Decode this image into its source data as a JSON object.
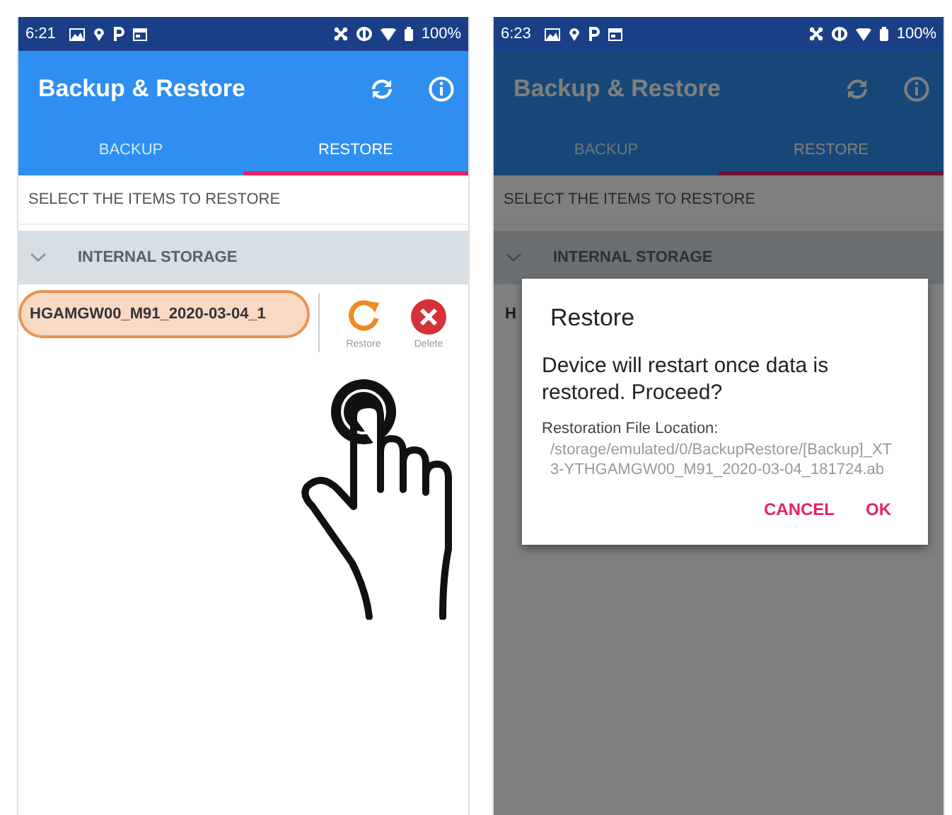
{
  "screens": [
    {
      "dimmed": false,
      "tap_hint": true,
      "status_bar": {
        "time": "6:21",
        "battery": "100%"
      },
      "app_bar": {
        "title": "Backup & Restore"
      },
      "tabs": [
        {
          "label": "BACKUP",
          "selected": false
        },
        {
          "label": "RESTORE",
          "selected": true
        }
      ],
      "section_header": "SELECT THE ITEMS TO RESTORE",
      "group": {
        "label": "INTERNAL STORAGE",
        "expanded": true
      },
      "items": [
        {
          "name": "HGAMGW00_M91_2020-03-04_1",
          "highlighted": true
        }
      ],
      "actions": [
        {
          "kind": "restore",
          "label": "Restore"
        },
        {
          "kind": "delete",
          "label": "Delete"
        }
      ]
    },
    {
      "dimmed": true,
      "status_bar": {
        "time": "6:23",
        "battery": "100%"
      },
      "app_bar": {
        "title": "Backup & Restore"
      },
      "tabs": [
        {
          "label": "BACKUP",
          "selected": false
        },
        {
          "label": "RESTORE",
          "selected": true
        }
      ],
      "section_header": "SELECT THE ITEMS TO RESTORE",
      "group": {
        "label": "INTERNAL STORAGE",
        "expanded": true
      },
      "items": [
        {
          "name": "H",
          "highlighted": false
        }
      ],
      "dialog": {
        "title": "Restore",
        "message": "Device will restart once data is restored. Proceed?",
        "location_label": "Restoration File Location:",
        "location": "/storage/emulated/0/BackupRestore/[Backup]_XT3-YTHGAMGW00_M91_2020-03-04_181724.ab",
        "buttons": [
          "CANCEL",
          "OK"
        ]
      }
    }
  ]
}
